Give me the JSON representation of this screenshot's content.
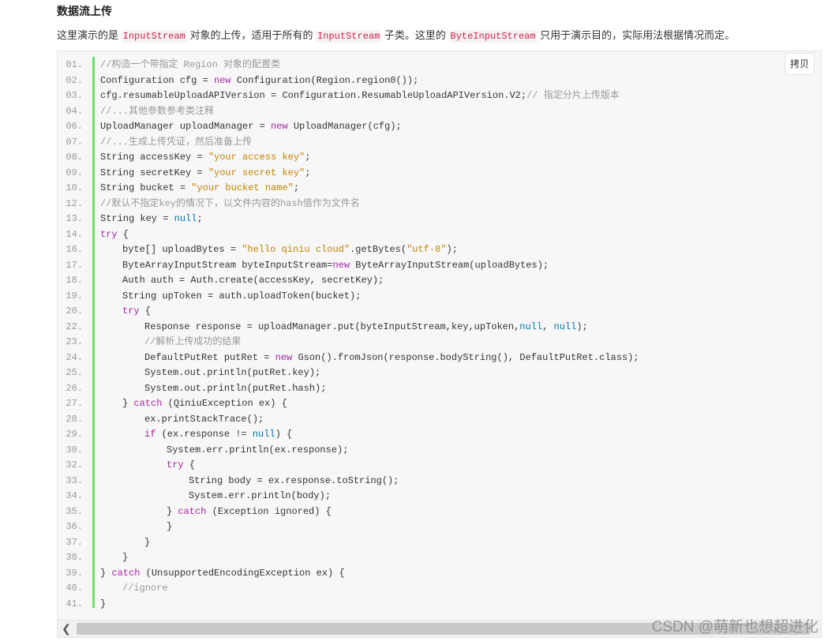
{
  "heading": "数据流上传",
  "description": {
    "part1": "这里演示的是 ",
    "code1": "InputStream",
    "part2": " 对象的上传，适用于所有的 ",
    "code2": "InputStream",
    "part3": " 子类。这里的 ",
    "code3": "ByteInputStream",
    "part4": " 只用于演示目的，实际用法根据情况而定。"
  },
  "copy_button": "拷贝",
  "watermark": "CSDN @萌新也想超进化",
  "code_lines": [
    {
      "n": "01.",
      "i": 0,
      "t": [
        [
          "cm",
          "//构造一个带指定 Region 对象的配置类"
        ]
      ]
    },
    {
      "n": "02.",
      "i": 0,
      "t": [
        [
          "",
          "Configuration cfg = "
        ],
        [
          "kw",
          "new"
        ],
        [
          "",
          " Configuration(Region.region0());"
        ]
      ]
    },
    {
      "n": "03.",
      "i": 0,
      "t": [
        [
          "",
          "cfg.resumableUploadAPIVersion = Configuration.ResumableUploadAPIVersion.V2;"
        ],
        [
          "cm",
          "// 指定分片上传版本"
        ]
      ]
    },
    {
      "n": "04.",
      "i": 0,
      "t": [
        [
          "cm",
          "//...其他参数参考类注释"
        ]
      ]
    },
    {
      "n": "06.",
      "i": 0,
      "t": [
        [
          "",
          "UploadManager uploadManager = "
        ],
        [
          "kw",
          "new"
        ],
        [
          "",
          " UploadManager(cfg);"
        ]
      ]
    },
    {
      "n": "07.",
      "i": 0,
      "t": [
        [
          "cm",
          "//...生成上传凭证，然后准备上传"
        ]
      ]
    },
    {
      "n": "08.",
      "i": 0,
      "t": [
        [
          "",
          "String accessKey = "
        ],
        [
          "str",
          "\"your access key\""
        ],
        [
          "",
          ";"
        ]
      ]
    },
    {
      "n": "09.",
      "i": 0,
      "t": [
        [
          "",
          "String secretKey = "
        ],
        [
          "str",
          "\"your secret key\""
        ],
        [
          "",
          ";"
        ]
      ]
    },
    {
      "n": "10.",
      "i": 0,
      "t": [
        [
          "",
          "String bucket = "
        ],
        [
          "str",
          "\"your bucket name\""
        ],
        [
          "",
          ";"
        ]
      ]
    },
    {
      "n": "12.",
      "i": 0,
      "t": [
        [
          "cm",
          "//默认不指定key的情况下，以文件内容的hash值作为文件名"
        ]
      ]
    },
    {
      "n": "13.",
      "i": 0,
      "t": [
        [
          "",
          "String key = "
        ],
        [
          "kw2",
          "null"
        ],
        [
          "",
          ";"
        ]
      ]
    },
    {
      "n": "14.",
      "i": 0,
      "t": [
        [
          "kw",
          "try"
        ],
        [
          "",
          " {"
        ]
      ]
    },
    {
      "n": "16.",
      "i": 1,
      "t": [
        [
          "",
          "byte[] uploadBytes = "
        ],
        [
          "str",
          "\"hello qiniu cloud\""
        ],
        [
          "",
          ".getBytes("
        ],
        [
          "str",
          "\"utf-8\""
        ],
        [
          "",
          ");"
        ]
      ]
    },
    {
      "n": "17.",
      "i": 1,
      "t": [
        [
          "",
          "ByteArrayInputStream byteInputStream="
        ],
        [
          "kw",
          "new"
        ],
        [
          "",
          " ByteArrayInputStream(uploadBytes);"
        ]
      ]
    },
    {
      "n": "18.",
      "i": 1,
      "t": [
        [
          "",
          "Auth auth = Auth.create(accessKey, secretKey);"
        ]
      ]
    },
    {
      "n": "19.",
      "i": 1,
      "t": [
        [
          "",
          "String upToken = auth.uploadToken(bucket);"
        ]
      ]
    },
    {
      "n": "20.",
      "i": 1,
      "t": [
        [
          "kw",
          "try"
        ],
        [
          "",
          " {"
        ]
      ]
    },
    {
      "n": "22.",
      "i": 2,
      "t": [
        [
          "",
          "Response response = uploadManager.put(byteInputStream,key,upToken,"
        ],
        [
          "kw2",
          "null"
        ],
        [
          "",
          ", "
        ],
        [
          "kw2",
          "null"
        ],
        [
          "",
          ");"
        ]
      ]
    },
    {
      "n": "23.",
      "i": 2,
      "t": [
        [
          "cm",
          "//解析上传成功的结果"
        ]
      ]
    },
    {
      "n": "24.",
      "i": 2,
      "t": [
        [
          "",
          "DefaultPutRet putRet = "
        ],
        [
          "kw",
          "new"
        ],
        [
          "",
          " Gson().fromJson(response.bodyString(), DefaultPutRet.class);"
        ]
      ]
    },
    {
      "n": "25.",
      "i": 2,
      "t": [
        [
          "",
          "System.out.println(putRet.key);"
        ]
      ]
    },
    {
      "n": "26.",
      "i": 2,
      "t": [
        [
          "",
          "System.out.println(putRet.hash);"
        ]
      ]
    },
    {
      "n": "27.",
      "i": 1,
      "t": [
        [
          "",
          "} "
        ],
        [
          "kw",
          "catch"
        ],
        [
          "",
          " (QiniuException ex) {"
        ]
      ]
    },
    {
      "n": "28.",
      "i": 2,
      "t": [
        [
          "",
          "ex.printStackTrace();"
        ]
      ]
    },
    {
      "n": "29.",
      "i": 2,
      "t": [
        [
          "kw",
          "if"
        ],
        [
          "",
          " (ex.response != "
        ],
        [
          "kw2",
          "null"
        ],
        [
          "",
          ") {"
        ]
      ]
    },
    {
      "n": "30.",
      "i": 3,
      "t": [
        [
          "",
          "System.err.println(ex.response);"
        ]
      ]
    },
    {
      "n": "32.",
      "i": 3,
      "t": [
        [
          "kw",
          "try"
        ],
        [
          "",
          " {"
        ]
      ]
    },
    {
      "n": "33.",
      "i": 4,
      "t": [
        [
          "",
          "String body = ex.response.toString();"
        ]
      ]
    },
    {
      "n": "34.",
      "i": 4,
      "t": [
        [
          "",
          "System.err.println(body);"
        ]
      ]
    },
    {
      "n": "35.",
      "i": 3,
      "t": [
        [
          "",
          "} "
        ],
        [
          "kw",
          "catch"
        ],
        [
          "",
          " (Exception ignored) {"
        ]
      ]
    },
    {
      "n": "36.",
      "i": 3,
      "t": [
        [
          "",
          "}"
        ]
      ]
    },
    {
      "n": "37.",
      "i": 2,
      "t": [
        [
          "",
          "}"
        ]
      ]
    },
    {
      "n": "38.",
      "i": 1,
      "t": [
        [
          "",
          "}"
        ]
      ]
    },
    {
      "n": "39.",
      "i": 0,
      "t": [
        [
          "",
          "} "
        ],
        [
          "kw",
          "catch"
        ],
        [
          "",
          " (UnsupportedEncodingException ex) {"
        ]
      ]
    },
    {
      "n": "40.",
      "i": 1,
      "t": [
        [
          "cm",
          "//ignore"
        ]
      ]
    },
    {
      "n": "41.",
      "i": 0,
      "t": [
        [
          "",
          "}"
        ]
      ]
    }
  ]
}
